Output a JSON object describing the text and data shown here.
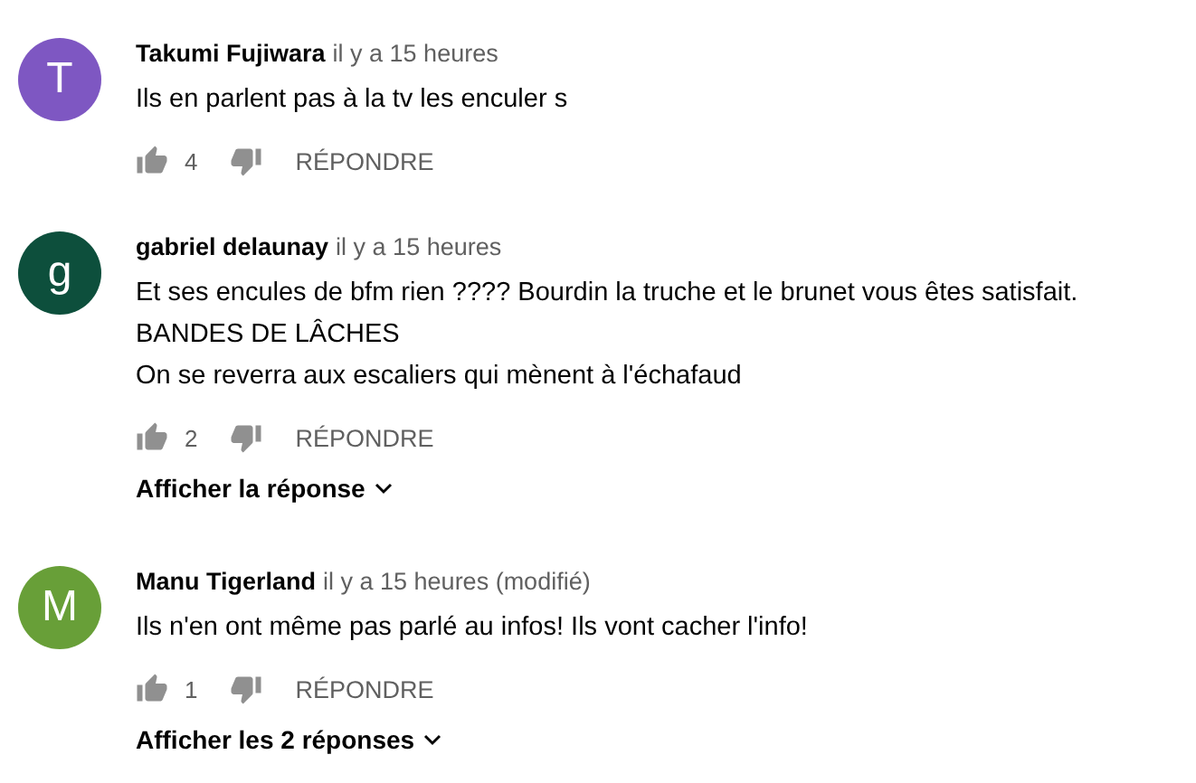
{
  "comments": [
    {
      "initial": "T",
      "color": "#7e57c2",
      "author": "Takumi Fujiwara",
      "time": "il y a 15 heures",
      "body": [
        "Ils en parlent pas à la tv les enculer s"
      ],
      "likes": "4",
      "reply": "RÉPONDRE"
    },
    {
      "initial": "g",
      "color": "#0d4f3c",
      "author": "gabriel delaunay",
      "time": "il y a 15 heures",
      "body": [
        "Et ses encules de bfm rien ???? Bourdin la truche et le brunet vous êtes satisfait.",
        "BANDES DE LÂCHES",
        "On se reverra aux escaliers qui mènent à l'échafaud"
      ],
      "likes": "2",
      "reply": "RÉPONDRE",
      "replies": "Afficher la réponse"
    },
    {
      "initial": "M",
      "color": "#689f38",
      "author": "Manu Tigerland",
      "time": "il y a 15 heures (modifié)",
      "body": [
        "Ils n'en ont même pas parlé au infos! Ils vont cacher l'info!"
      ],
      "likes": "1",
      "reply": "RÉPONDRE",
      "replies": "Afficher les 2 réponses"
    }
  ]
}
